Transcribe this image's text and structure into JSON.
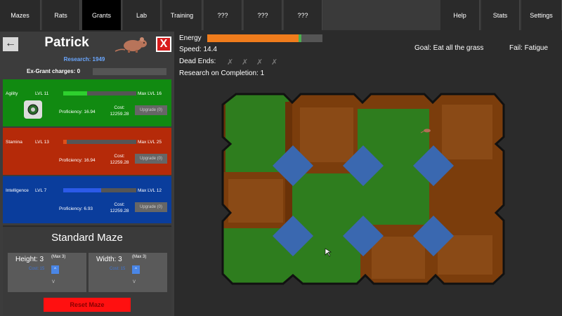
{
  "nav": {
    "tabs": [
      "Mazes",
      "Rats",
      "Grants",
      "Lab",
      "Training",
      "???",
      "???",
      "???"
    ],
    "active_tab": "Grants",
    "right_tabs": [
      "Help",
      "Stats",
      "Settings"
    ]
  },
  "rat": {
    "name": "Patrick",
    "research": "Research: 1949",
    "exgrant": "Ex-Grant charges: 0"
  },
  "stats": [
    {
      "name": "Agility",
      "level": "LVL 11",
      "max": "Max LVL 16",
      "proficiency": "Proficiency: 16.94",
      "cost_label": "Cost:",
      "cost": "12259.28",
      "upgrade": "Upgrade (0)",
      "progress": 0.33,
      "color": "#118a11",
      "fill": "#2ed02e"
    },
    {
      "name": "Stamina",
      "level": "LVL 13",
      "max": "Max LVL 25",
      "proficiency": "Proficiency: 16.94",
      "cost_label": "Cost:",
      "cost": "12259.28",
      "upgrade": "Upgrade (0)",
      "progress": 0.05,
      "color": "#b52a09",
      "fill": "#e0501a"
    },
    {
      "name": "Intelligence",
      "level": "LVL 7",
      "max": "Max LVL 12",
      "proficiency": "Proficiency: 6.93",
      "cost_label": "Cost:",
      "cost": "12259.28",
      "upgrade": "Upgrade (0)",
      "progress": 0.52,
      "color": "#0a3d9c",
      "fill": "#2b5ae8"
    }
  ],
  "maze": {
    "title": "Standard Maze",
    "height_label": "Height: 3",
    "height_max": "(Max 3)",
    "height_cost": "Cost: 15",
    "width_label": "Width: 3",
    "width_max": "(Max 3)",
    "width_cost": "Cost: 15",
    "up": "^",
    "down": "v",
    "reset": "Reset Maze"
  },
  "hud": {
    "energy_label": "Energy",
    "energy": 0.82,
    "speed": "Speed: 14.4",
    "dead_ends": "Dead Ends:",
    "research_completion": "Research on Completion: 1",
    "goal": "Goal: Eat all the grass",
    "fail": "Fail: Fatigue"
  },
  "colors": {
    "grass": "#2e7d1e",
    "dirt": "#7b3d0c",
    "tile": "#3a68b0",
    "energy": "#f07c1c"
  }
}
